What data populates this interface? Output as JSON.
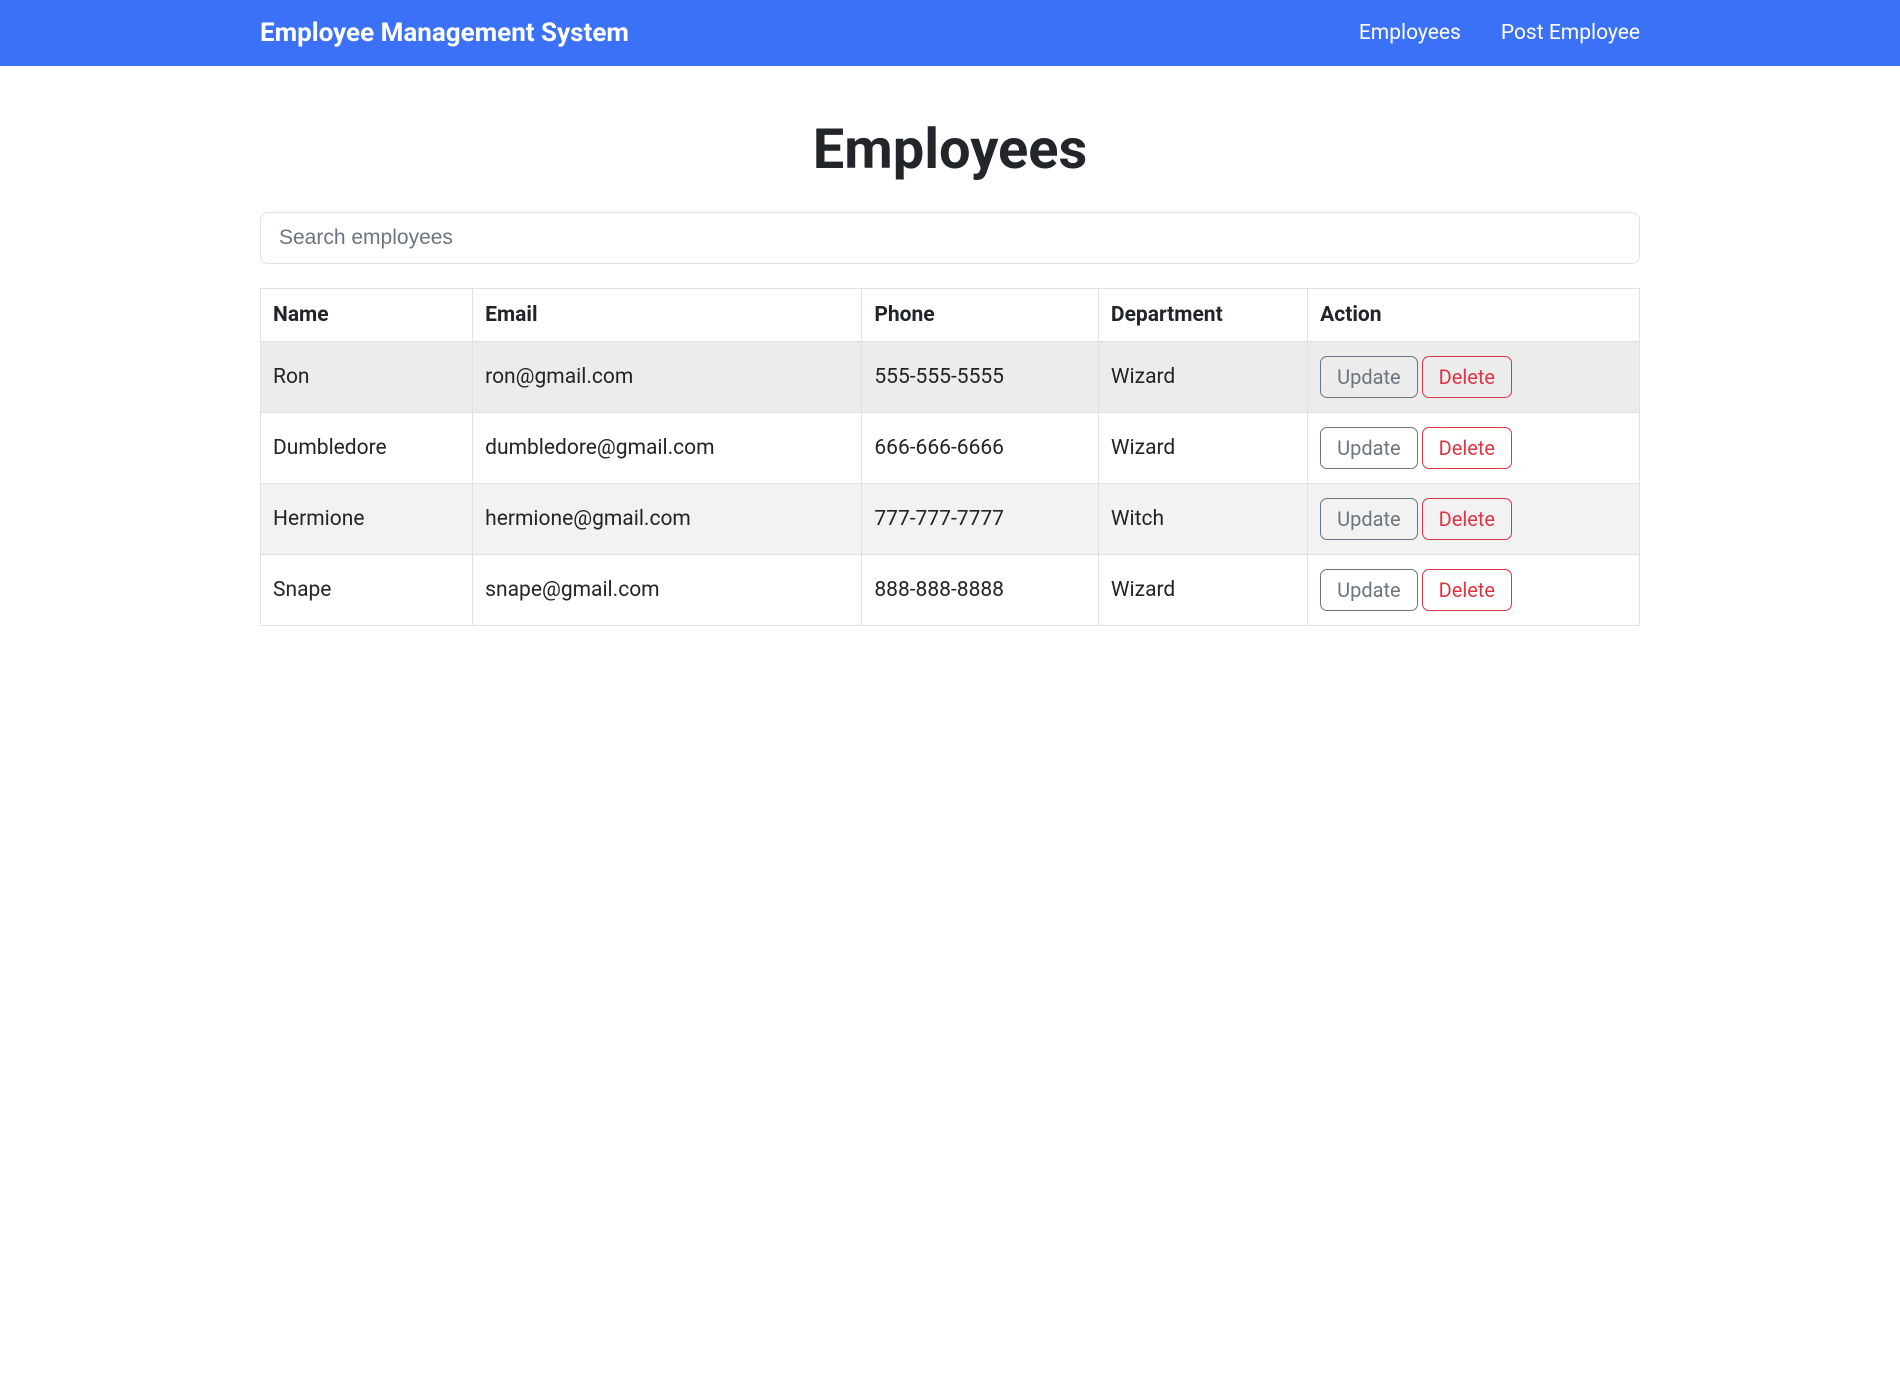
{
  "navbar": {
    "brand": "Employee Management System",
    "links": [
      {
        "label": "Employees"
      },
      {
        "label": "Post Employee"
      }
    ]
  },
  "page": {
    "title": "Employees"
  },
  "search": {
    "placeholder": "Search employees",
    "value": ""
  },
  "table": {
    "columns": [
      "Name",
      "Email",
      "Phone",
      "Department",
      "Action"
    ],
    "rows": [
      {
        "name": "Ron",
        "email": "ron@gmail.com",
        "phone": "555-555-5555",
        "department": "Wizard"
      },
      {
        "name": "Dumbledore",
        "email": "dumbledore@gmail.com",
        "phone": "666-666-6666",
        "department": "Wizard"
      },
      {
        "name": "Hermione",
        "email": "hermione@gmail.com",
        "phone": "777-777-7777",
        "department": "Witch"
      },
      {
        "name": "Snape",
        "email": "snape@gmail.com",
        "phone": "888-888-8888",
        "department": "Wizard"
      }
    ],
    "actions": {
      "update_label": "Update",
      "delete_label": "Delete"
    }
  }
}
